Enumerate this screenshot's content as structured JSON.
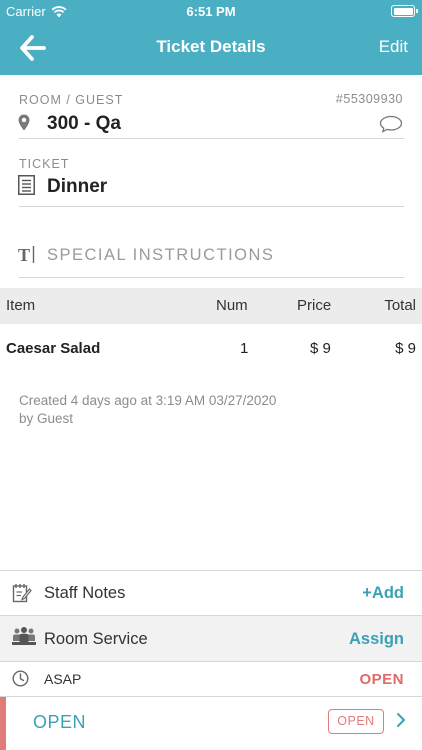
{
  "status_bar": {
    "carrier": "Carrier",
    "time": "6:51 PM"
  },
  "nav": {
    "title": "Ticket Details",
    "edit_label": "Edit"
  },
  "room_guest": {
    "label": "ROOM / GUEST",
    "value": "300 - Qa",
    "ticket_number": "#55309930"
  },
  "ticket": {
    "label": "TICKET",
    "value": "Dinner"
  },
  "special_instructions": {
    "placeholder": "SPECIAL INSTRUCTIONS"
  },
  "table": {
    "headers": {
      "item": "Item",
      "num": "Num",
      "price": "Price",
      "total": "Total"
    },
    "rows": [
      {
        "item": "Caesar Salad",
        "num": "1",
        "price": "$ 9",
        "total": "$ 9"
      }
    ]
  },
  "created": {
    "line1": "Created 4 days ago at 3:19 AM 03/27/2020",
    "line2": "by Guest"
  },
  "staff_notes": {
    "label": "Staff Notes",
    "action": "+Add"
  },
  "room_service": {
    "label": "Room Service",
    "action": "Assign"
  },
  "schedule": {
    "label": "ASAP",
    "status": "OPEN"
  },
  "footer": {
    "status_text": "OPEN",
    "badge": "OPEN"
  },
  "colors": {
    "accent": "#4bafc4",
    "link": "#3aa2b6",
    "open_status": "#e06a6a"
  }
}
